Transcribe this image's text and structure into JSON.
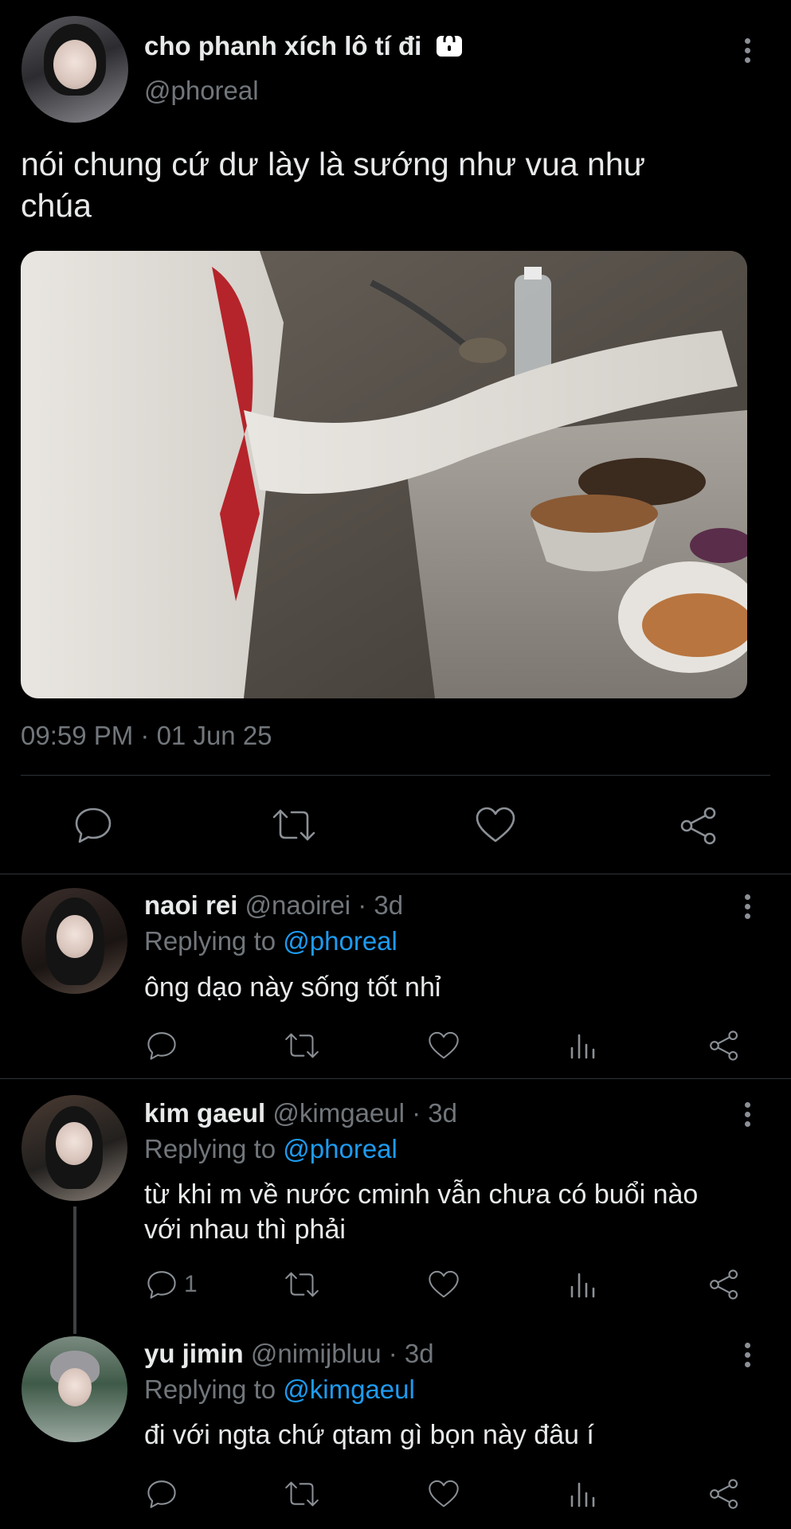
{
  "main_tweet": {
    "display_name": "cho phanh xích lô tí đi",
    "handle": "@phoreal",
    "text_line1": "nói chung cứ dư lày là sướng như vua như",
    "text_line2": "chúa",
    "timestamp": "09:59 PM · 01 Jun 25"
  },
  "replies": [
    {
      "display_name": "naoi rei",
      "handle_time": "@naoirei · 3d",
      "replying_prefix": "Replying to ",
      "replying_to": "@phoreal",
      "text_line1": "ông dạo này sống tốt nhỉ",
      "text_line2": "",
      "reply_count": ""
    },
    {
      "display_name": "kim gaeul",
      "handle_time": "@kimgaeul · 3d",
      "replying_prefix": "Replying to ",
      "replying_to": "@phoreal",
      "text_line1": "từ khi m về nước cminh vẫn chưa có buổi nào",
      "text_line2": "với nhau thì phải",
      "reply_count": "1"
    },
    {
      "display_name": "yu jimin",
      "handle_time": "@nimijbluu · 3d",
      "replying_prefix": "Replying to ",
      "replying_to": "@kimgaeul",
      "text_line1": "đi với ngta chứ qtam gì bọn này đâu í",
      "text_line2": "",
      "reply_count": ""
    }
  ],
  "icons": {
    "protected": "lock-icon",
    "reply": "reply-icon",
    "retweet": "retweet-icon",
    "like": "heart-icon",
    "share": "share-icon",
    "views": "views-icon",
    "more": "more-icon"
  },
  "colors": {
    "background": "#000000",
    "text": "#e7e9ea",
    "muted": "#71767b",
    "link": "#1d9bf0",
    "divider": "#2f3336"
  }
}
